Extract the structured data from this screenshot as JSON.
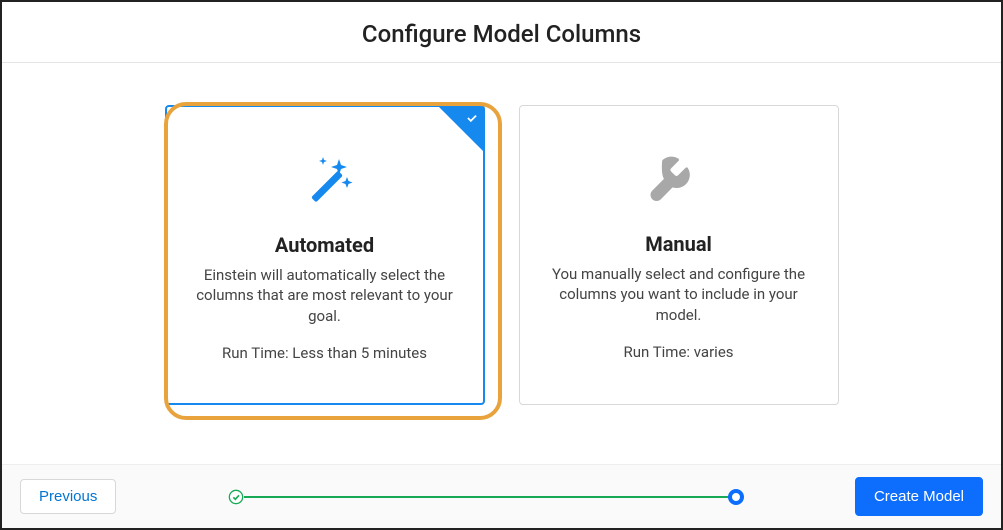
{
  "header": {
    "title": "Configure Model Columns"
  },
  "options": {
    "automated": {
      "title": "Automated",
      "description": "Einstein will automatically select the columns that are most relevant to your goal.",
      "runtime": "Run Time: Less than 5 minutes"
    },
    "manual": {
      "title": "Manual",
      "description": "You manually select and configure the columns you want to include in your model.",
      "runtime": "Run Time: varies"
    }
  },
  "footer": {
    "previous": "Previous",
    "create": "Create Model"
  }
}
